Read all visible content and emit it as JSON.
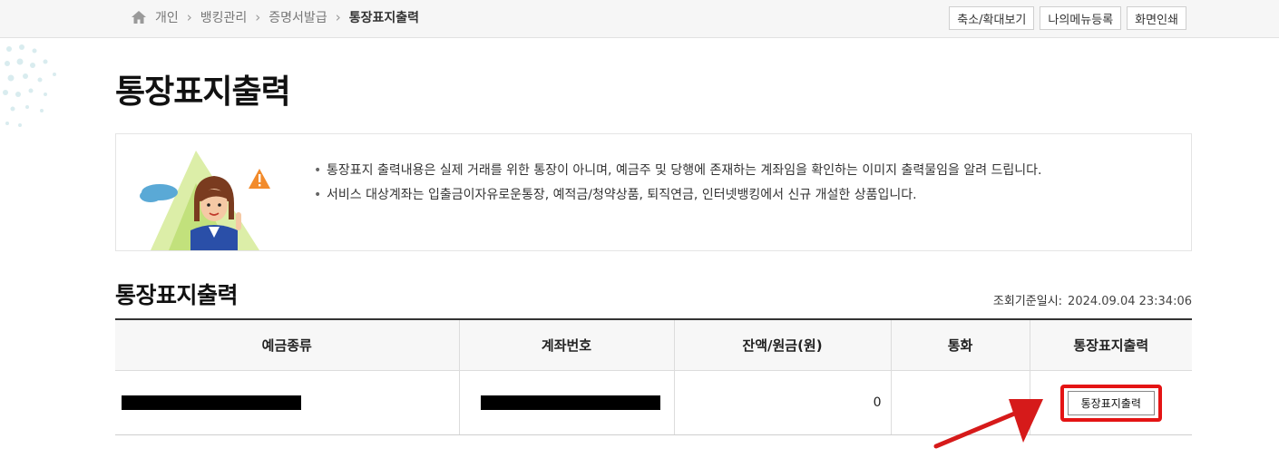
{
  "breadcrumb": {
    "items": [
      "개인",
      "뱅킹관리",
      "증명서발급"
    ],
    "current": "통장표지출력"
  },
  "top_buttons": {
    "zoom": "축소/확대보기",
    "my_menu": "나의메뉴등록",
    "print_screen": "화면인쇄"
  },
  "page": {
    "title": "통장표지출력"
  },
  "notice": {
    "lines": [
      "통장표지 출력내용은 실제 거래를 위한 통장이 아니며, 예금주 및 당행에 존재하는 계좌임을 확인하는 이미지 출력물임을 알려 드립니다.",
      "서비스 대상계좌는 입출금이자유로운통장, 예적금/청약상품, 퇴직연금, 인터넷뱅킹에서 신규 개설한 상품입니다."
    ]
  },
  "section": {
    "title": "통장표지출력",
    "as_of_label": "조회기준일시:",
    "as_of_value": "2024.09.04 23:34:06"
  },
  "table": {
    "headers": [
      "예금종류",
      "계좌번호",
      "잔액/원금(원)",
      "통화",
      "통장표지출력"
    ],
    "rows": [
      {
        "balance": "0",
        "currency": "",
        "print_label": "통장표지출력"
      }
    ]
  },
  "colors": {
    "highlight": "#e41414",
    "accent_blue": "#2a4fa8"
  },
  "icons": [
    "home-icon",
    "chevron-right-icon",
    "warning-icon",
    "arrow-icon"
  ]
}
